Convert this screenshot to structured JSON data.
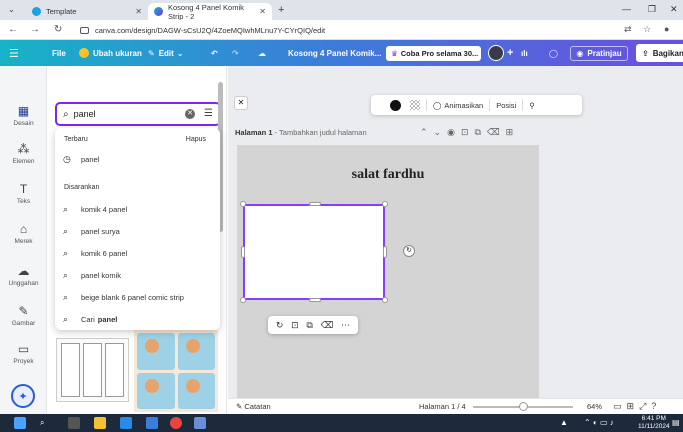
{
  "browser": {
    "tabs": [
      {
        "label": "Template"
      },
      {
        "label": "Kosong 4 Panel Komik Strip - 2"
      }
    ],
    "url": "canva.com/design/DAGW-sCsU2Q/4ZoeMQIwhMLnu7Y-CYrQIQ/edit"
  },
  "toolbar": {
    "file": "File",
    "resize": "Ubah ukuran",
    "edit": "Edit",
    "doc_title": "Kosong 4 Panel Komik...",
    "promo": "Coba Pro selama 30...",
    "preview": "Pratinjau",
    "share": "Bagikan",
    "brand_colors": {
      "teal": "#17b3c6",
      "blue": "#3a7fd8",
      "purple": "#6b4fe0",
      "accent": "#7d2ae8",
      "selection": "#8b3dff"
    }
  },
  "rail": {
    "items": [
      {
        "label": "Desain",
        "icon": "design-icon"
      },
      {
        "label": "Elemen",
        "icon": "elements-icon"
      },
      {
        "label": "Teks",
        "icon": "text-icon"
      },
      {
        "label": "Merek",
        "icon": "brand-icon"
      },
      {
        "label": "Unggahan",
        "icon": "upload-icon"
      },
      {
        "label": "Gambar",
        "icon": "draw-icon"
      },
      {
        "label": "Proyek",
        "icon": "projects-icon"
      }
    ]
  },
  "search": {
    "value": "panel",
    "recent_header": "Terbaru",
    "clear_label": "Hapus",
    "recent": [
      "panel"
    ],
    "suggested_header": "Disarankan",
    "suggestions": [
      "komik 4 panel",
      "panel surya",
      "komik 6 panel",
      "panel komik",
      "beige blank 6 panel comic strip"
    ],
    "search_for_prefix": "Cari",
    "search_for_term": "panel"
  },
  "context_toolbar": {
    "animate": "Animasikan",
    "position": "Posisi"
  },
  "page": {
    "header_bold": "Halaman 1",
    "header_sub": " - Tambahkan judul halaman",
    "title": "salat fardhu"
  },
  "status": {
    "notes": "Catatan",
    "page_indicator": "Halaman 1 / 4",
    "zoom": "64%",
    "zoom_level": 0.5
  },
  "taskbar": {
    "time": "6:41 PM",
    "date": "11/11/2024"
  }
}
